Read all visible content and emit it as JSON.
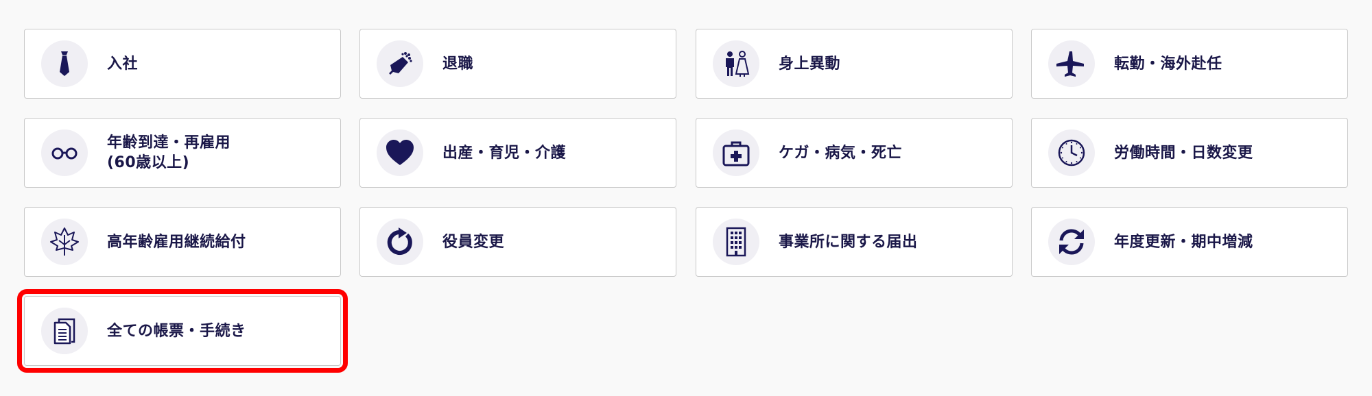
{
  "accent_color": "#1a1758",
  "highlight_color": "#ff0000",
  "items": [
    {
      "label": "入社",
      "icon": "tie-icon"
    },
    {
      "label": "退職",
      "icon": "bouquet-icon"
    },
    {
      "label": "身上異動",
      "icon": "couple-icon"
    },
    {
      "label": "転勤・海外赴任",
      "icon": "airplane-icon"
    },
    {
      "label": "年齢到達・再雇用\n(60歳以上)",
      "icon": "glasses-icon"
    },
    {
      "label": "出産・育児・介護",
      "icon": "heart-icon"
    },
    {
      "label": "ケガ・病気・死亡",
      "icon": "medical-kit-icon"
    },
    {
      "label": "労働時間・日数変更",
      "icon": "clock-icon"
    },
    {
      "label": "高年齢雇用継続給付",
      "icon": "maple-leaf-icon"
    },
    {
      "label": "役員変更",
      "icon": "refresh-arrow-icon"
    },
    {
      "label": "事業所に関する届出",
      "icon": "building-icon"
    },
    {
      "label": "年度更新・期中増減",
      "icon": "sync-arrows-icon"
    },
    {
      "label": "全ての帳票・手続き",
      "icon": "documents-icon"
    }
  ]
}
